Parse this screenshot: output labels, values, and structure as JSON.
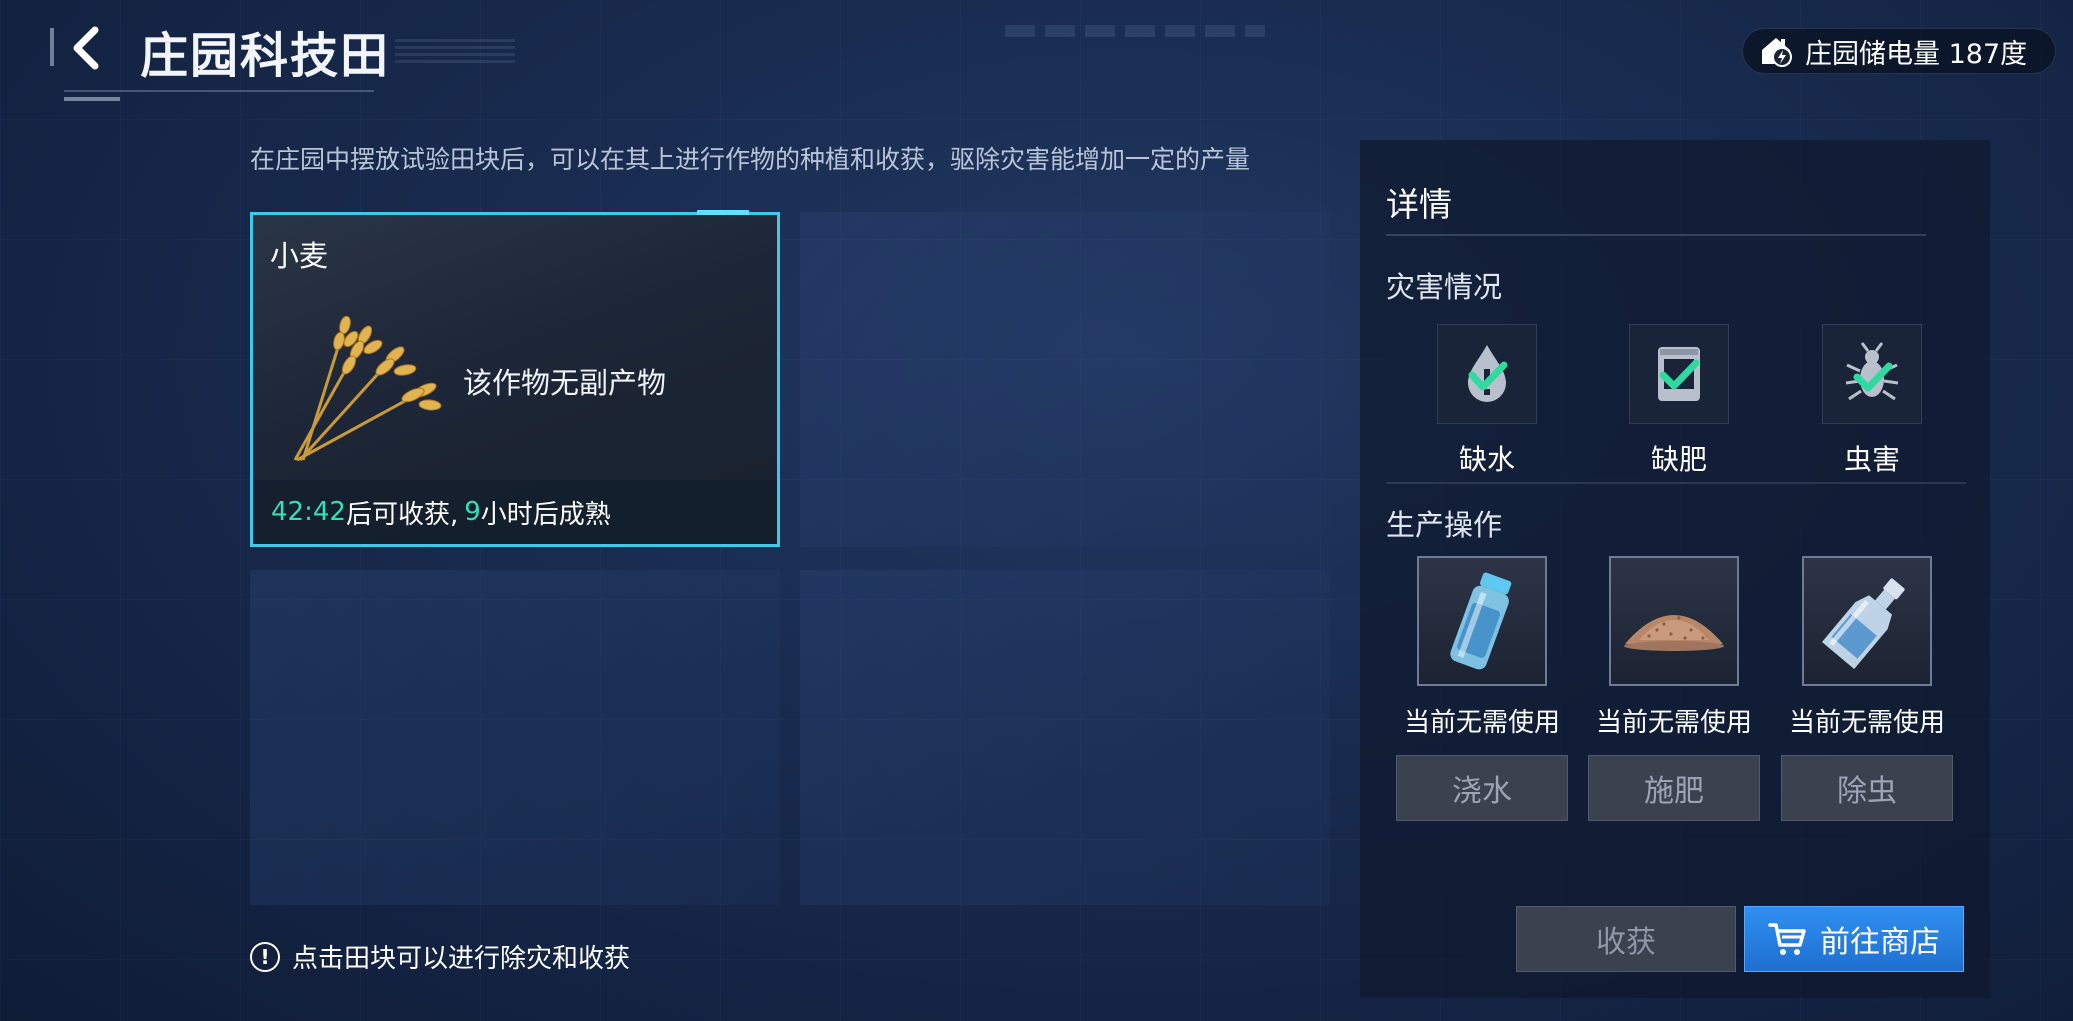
{
  "header": {
    "title": "庄园科技田",
    "energy_label": "庄园储电量 187度"
  },
  "intro": "在庄园中摆放试验田块后，可以在其上进行作物的种植和收获，驱除灾害能增加一定的产量",
  "plot": {
    "crop_name": "小麦",
    "byproduct": "该作物无副产物",
    "timer": "42:42",
    "timer_suffix": "后可收获,",
    "hours": "9",
    "hours_suffix": "小时后成熟"
  },
  "hint": "点击田块可以进行除灾和收获",
  "details": {
    "title": "详情",
    "disaster_title": "灾害情况",
    "disasters": [
      {
        "label": "缺水",
        "icon": "water-drop-icon",
        "status": "ok"
      },
      {
        "label": "缺肥",
        "icon": "fertilizer-bag-icon",
        "status": "ok"
      },
      {
        "label": "虫害",
        "icon": "bug-icon",
        "status": "ok"
      }
    ],
    "production_title": "生产操作",
    "operations": [
      {
        "status": "当前无需使用",
        "button": "浇水",
        "icon": "water-bottle-icon"
      },
      {
        "status": "当前无需使用",
        "button": "施肥",
        "icon": "fertilizer-pile-icon"
      },
      {
        "status": "当前无需使用",
        "button": "除虫",
        "icon": "pesticide-bottle-icon"
      }
    ],
    "harvest_button": "收获",
    "shop_button": "前往商店"
  },
  "colors": {
    "accent_cyan": "#3fc8e8",
    "timer_green": "#34e0b4",
    "check_green": "#2fd9a0",
    "shop_blue": "#1f6fd0"
  }
}
